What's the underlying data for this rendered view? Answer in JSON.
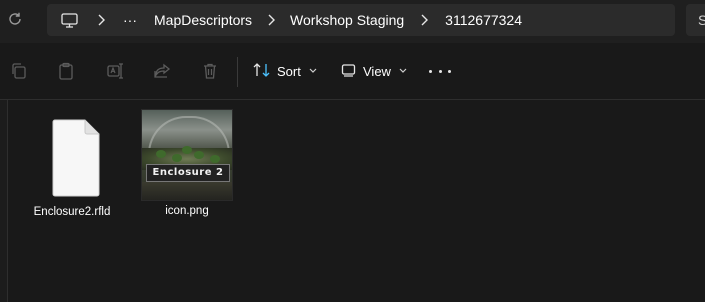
{
  "breadcrumb": {
    "overflow": "···",
    "items": [
      "MapDescriptors",
      "Workshop Staging",
      "3112677324"
    ]
  },
  "search": {
    "partial_text": "S"
  },
  "toolbar": {
    "sort_label": "Sort",
    "view_label": "View",
    "icons": [
      "copy-icon",
      "paste-icon",
      "rename-icon",
      "share-icon",
      "delete-icon"
    ]
  },
  "files": [
    {
      "name": "Enclosure2.rfld",
      "kind": "document"
    },
    {
      "name": "icon.png",
      "kind": "image",
      "thumbnail_text": "Enclosure 2"
    }
  ],
  "colors": {
    "window_bg": "#191919",
    "address_bg": "#2b2b2b",
    "text": "#ffffff"
  }
}
